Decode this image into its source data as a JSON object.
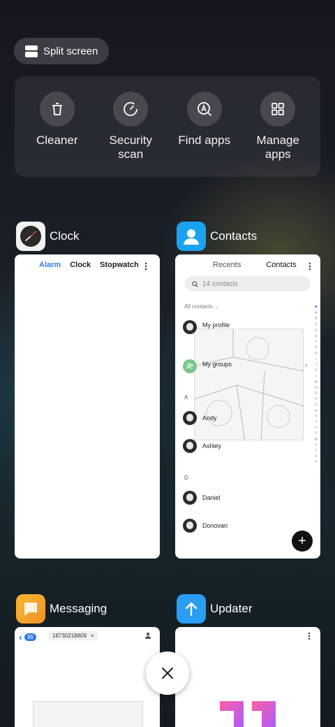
{
  "split_screen": {
    "label": "Split screen"
  },
  "tools": [
    {
      "label": "Cleaner",
      "icon": "trash-icon"
    },
    {
      "label": "Security scan",
      "icon": "shield-gauge-icon"
    },
    {
      "label": "Find apps",
      "icon": "app-search-icon"
    },
    {
      "label": "Manage apps",
      "icon": "grid-icon"
    }
  ],
  "apps": {
    "clock": {
      "name": "Clock",
      "tabs": [
        "Alarm",
        "Clock",
        "Stopwatch"
      ],
      "active_tab_color": "#2b7de9"
    },
    "contacts": {
      "name": "Contacts",
      "tabs": [
        "Recents",
        "Contacts"
      ],
      "search_placeholder": "14 contacts",
      "filter": "All contacts",
      "rows": {
        "profile": "My profile",
        "groups": "My groups",
        "section_a": "A",
        "andy": "Andy",
        "ashley": "Ashley",
        "section_d": "D",
        "daniel": "Daniel",
        "donovan": "Donovan"
      },
      "alphabet": [
        "♥",
        "A",
        "B",
        "C",
        "D",
        "E",
        "F",
        "G",
        "H",
        "I",
        "J",
        "K",
        "L",
        "M",
        "N",
        "O",
        "P",
        "Q",
        "R",
        "S",
        "T",
        "U",
        "V",
        "W",
        "X",
        "Y",
        "Z",
        "#"
      ]
    },
    "messaging": {
      "name": "Messaging",
      "badge": "36",
      "number_chip": "18730218809"
    },
    "updater": {
      "name": "Updater"
    }
  },
  "colors": {
    "clock_accent": "#2b7de9",
    "contacts_icon": "#1aa3f0",
    "messaging_icon": "#f5a623",
    "updater_icon": "#2a9df4"
  }
}
